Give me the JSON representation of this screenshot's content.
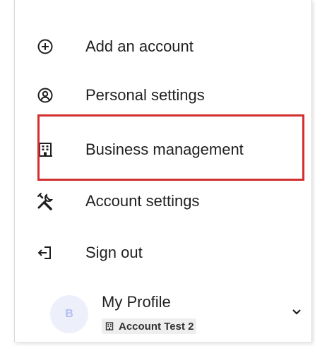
{
  "menu": {
    "items": [
      {
        "label": "Add an account",
        "icon": "plus-circle-icon"
      },
      {
        "label": "Personal settings",
        "icon": "user-circle-icon"
      },
      {
        "label": "Business management",
        "icon": "building-icon"
      },
      {
        "label": "Account settings",
        "icon": "tools-icon"
      },
      {
        "label": "Sign out",
        "icon": "sign-out-icon"
      }
    ]
  },
  "profile": {
    "avatar_initial": "B",
    "name": "My Profile",
    "account": "Account Test 2"
  },
  "colors": {
    "highlight": "#d32f2f",
    "text": "#1f1f1f",
    "avatar_bg": "#edf0fb",
    "avatar_text": "#b5bdf0"
  }
}
